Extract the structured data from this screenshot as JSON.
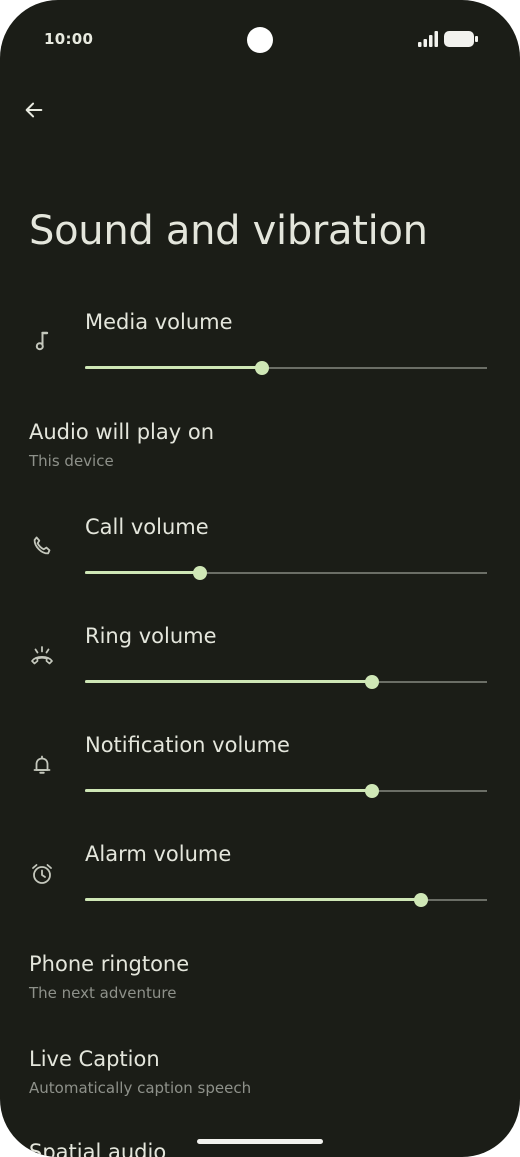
{
  "status_bar": {
    "time": "10:00",
    "signal_icon": "cellular-signal-icon",
    "battery_icon": "battery-full-icon"
  },
  "header": {
    "back_icon": "arrow-back-icon",
    "title": "Sound and vibration"
  },
  "sliders": {
    "media": {
      "label": "Media volume",
      "icon": "music-note-icon",
      "value_percent": 44
    },
    "call": {
      "label": "Call volume",
      "icon": "phone-icon",
      "value_percent": 28.5
    },
    "ring": {
      "label": "Ring volume",
      "icon": "ring-volume-icon",
      "value_percent": 71.5
    },
    "notification": {
      "label": "Notification volume",
      "icon": "bell-icon",
      "value_percent": 71.5
    },
    "alarm": {
      "label": "Alarm volume",
      "icon": "alarm-clock-icon",
      "value_percent": 83.5
    }
  },
  "audio_output": {
    "title": "Audio will play on",
    "summary": "This device"
  },
  "phone_ringtone": {
    "title": "Phone ringtone",
    "summary": "The next adventure"
  },
  "live_caption": {
    "title": "Live Caption",
    "summary": "Automatically caption speech"
  },
  "spatial_audio": {
    "title": "Spatial audio"
  },
  "colors": {
    "background": "#1b1d17",
    "accent": "#cfe7b6",
    "text_primary": "#e4e6dc",
    "text_secondary": "#8e918a"
  }
}
